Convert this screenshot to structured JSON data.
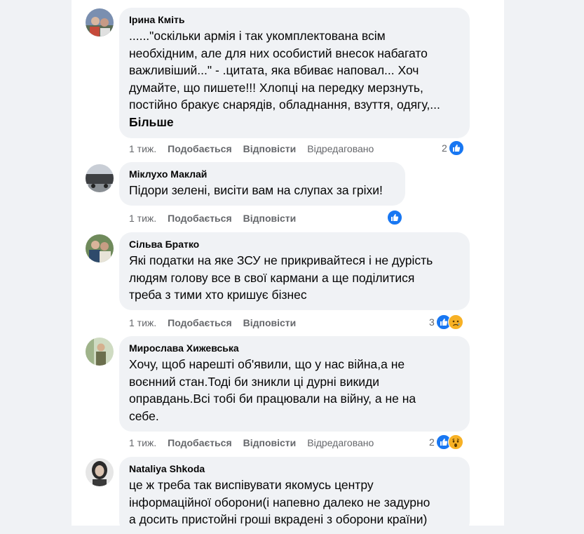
{
  "comments": [
    {
      "author": "Ірина Кміть",
      "lines": [
        "......\"оскільки армія і так укомплектована всім",
        "необхідним, але для них особистий внесок набагато",
        "важливіший...\" - .цитата, яка вбиває наповал... Хоч",
        "думайте, що пишете!!! Хлопці на передку мерзнуть,",
        "постійно бракує снарядів, обладнання, взуття, одягу,..."
      ],
      "more": "Більше",
      "time": "1 тиж.",
      "like_label": "Подобається",
      "reply_label": "Відповісти",
      "edited": "Відредаговано",
      "reaction_count": "2",
      "reactions": [
        "like-icon"
      ]
    },
    {
      "author": "Міклухо Маклай",
      "lines": [
        "Підори зелені, висіти вам на слупах за гріхи!"
      ],
      "time": "1 тиж.",
      "like_label": "Подобається",
      "reply_label": "Відповісти",
      "reactions": [
        "like-icon"
      ]
    },
    {
      "author": "Сільва Братко",
      "lines": [
        "Які податки на яке ЗСУ не прикривайтеся і не дурість",
        "людям голову все в свої кармани а ще поділитися",
        "треба з тими хто кришує бізнес"
      ],
      "time": "1 тиж.",
      "like_label": "Подобається",
      "reply_label": "Відповісти",
      "reaction_count": "3",
      "reactions": [
        "like-icon",
        "sad-icon"
      ]
    },
    {
      "author": "Мирослава Хижевська",
      "lines": [
        "Хочу, щоб нарешті об'явили, що у нас війна,а не",
        "воєнний стан.Тоді би зникли ці дурні викиди",
        "оправдань.Всі тобі би працювали на війну, а не на",
        "себе."
      ],
      "time": "1 тиж.",
      "like_label": "Подобається",
      "reply_label": "Відповісти",
      "edited": "Відредаговано",
      "reaction_count": "2",
      "reactions": [
        "like-icon",
        "wow-icon"
      ]
    },
    {
      "author": "Nataliya Shkoda",
      "lines": [
        "це ж треба так виспівувати якомусь центру",
        "інформаційної оборони(і напевно далеко не задурно",
        "а досить пристойні гроші вкрадені з оборони країни)"
      ]
    }
  ]
}
